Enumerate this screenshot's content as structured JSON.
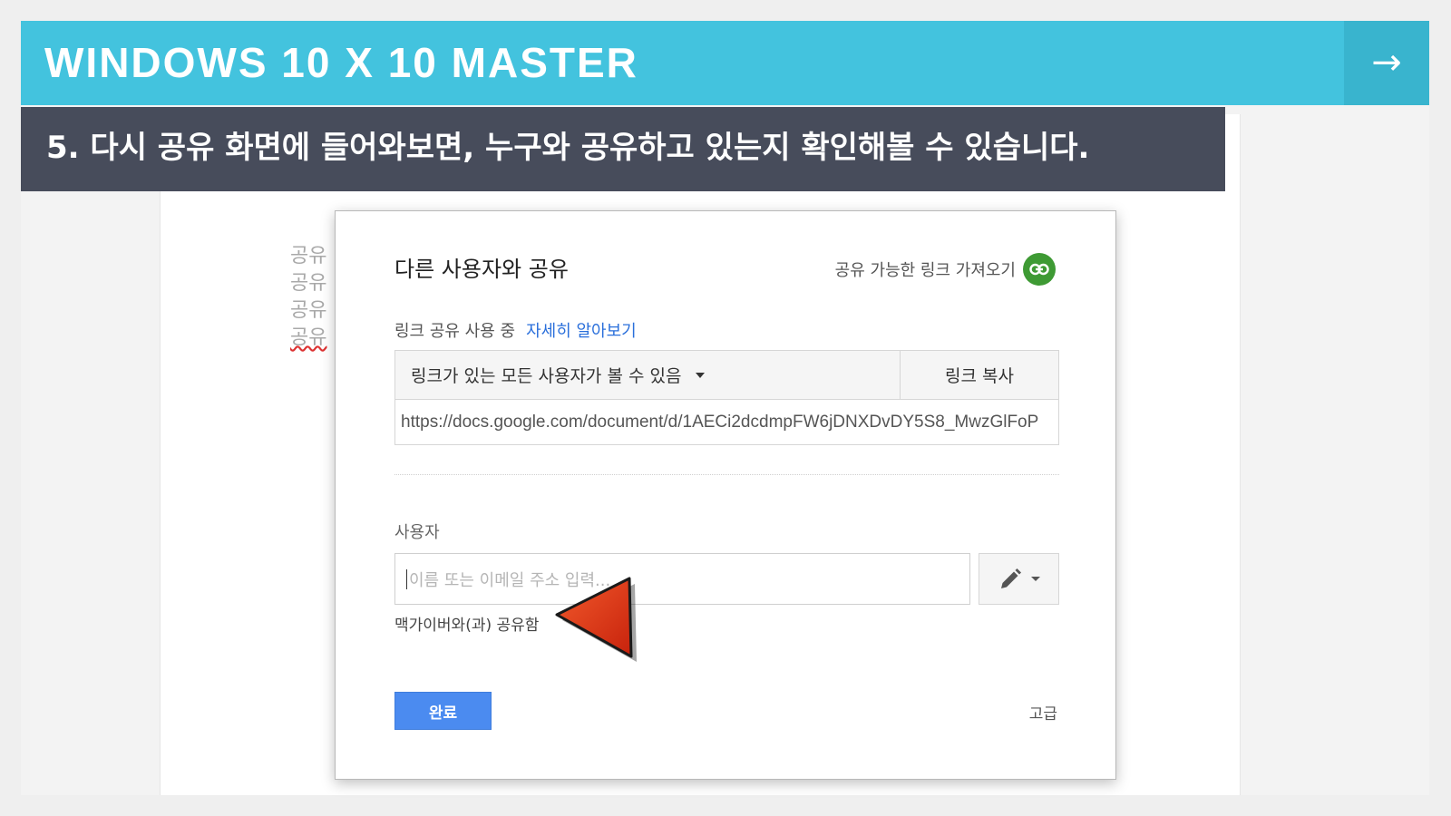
{
  "header": {
    "title": "WINDOWS 10 X 10 MASTER",
    "next_arrow": "→"
  },
  "caption": {
    "text": "5. 다시 공유 화면에 들어와보면, 누구와 공유하고 있는지 확인해볼 수 있습니다."
  },
  "document": {
    "lines": [
      "공유",
      "공유",
      "공유",
      "공유"
    ]
  },
  "dialog": {
    "title": "다른 사용자와 공유",
    "get_link_label": "공유 가능한 링크 가져오기",
    "link_sharing_label": "링크 공유 사용 중",
    "learn_more": "자세히 알아보기",
    "permission_select": "링크가 있는 모든 사용자가 볼 수 있음",
    "copy_link": "링크 복사",
    "url": "https://docs.google.com/document/d/1AECi2dcdmpFW6jDNXDvDY5S8_MwzGlFoP",
    "people_label": "사용자",
    "people_placeholder": "이름 또는 이메일 주소 입력...",
    "shared_with": "맥가이버와(과) 공유함",
    "done": "완료",
    "advanced": "고급"
  },
  "colors": {
    "header_bg": "#43c3de",
    "caption_bg": "#474c5b",
    "link_icon_bg": "#3e9a34",
    "primary_button": "#4b8bf0",
    "pointer_arrow": "#e0361a"
  },
  "icons": {
    "next": "arrow-right-icon",
    "link": "link-icon",
    "edit": "pencil-icon",
    "pointer": "red-pointer-arrow"
  }
}
